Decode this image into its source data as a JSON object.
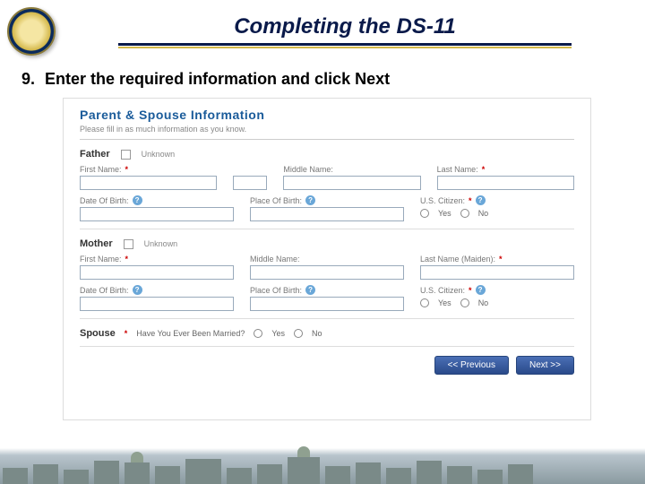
{
  "header": {
    "title": "Completing the DS-11"
  },
  "instruction": {
    "number": "9.",
    "text": "Enter the required information and click Next"
  },
  "form": {
    "title": "Parent & Spouse Information",
    "subtitle": "Please fill in as much information as you know.",
    "father": {
      "label": "Father",
      "unknown_label": "Unknown",
      "first_name_label": "First Name:",
      "middle_name_label": "Middle Name:",
      "last_name_label": "Last Name:",
      "dob_label": "Date Of Birth:",
      "pob_label": "Place Of Birth:",
      "citizen_label": "U.S. Citizen:",
      "yes": "Yes",
      "no": "No"
    },
    "mother": {
      "label": "Mother",
      "unknown_label": "Unknown",
      "first_name_label": "First Name:",
      "middle_name_label": "Middle Name:",
      "last_name_label": "Last Name (Maiden):",
      "dob_label": "Date Of Birth:",
      "pob_label": "Place Of Birth:",
      "citizen_label": "U.S. Citizen:",
      "yes": "Yes",
      "no": "No"
    },
    "spouse": {
      "label": "Spouse",
      "question": "Have You Ever Been Married?",
      "yes": "Yes",
      "no": "No"
    },
    "nav": {
      "previous": "<< Previous",
      "next": "Next >>"
    }
  }
}
